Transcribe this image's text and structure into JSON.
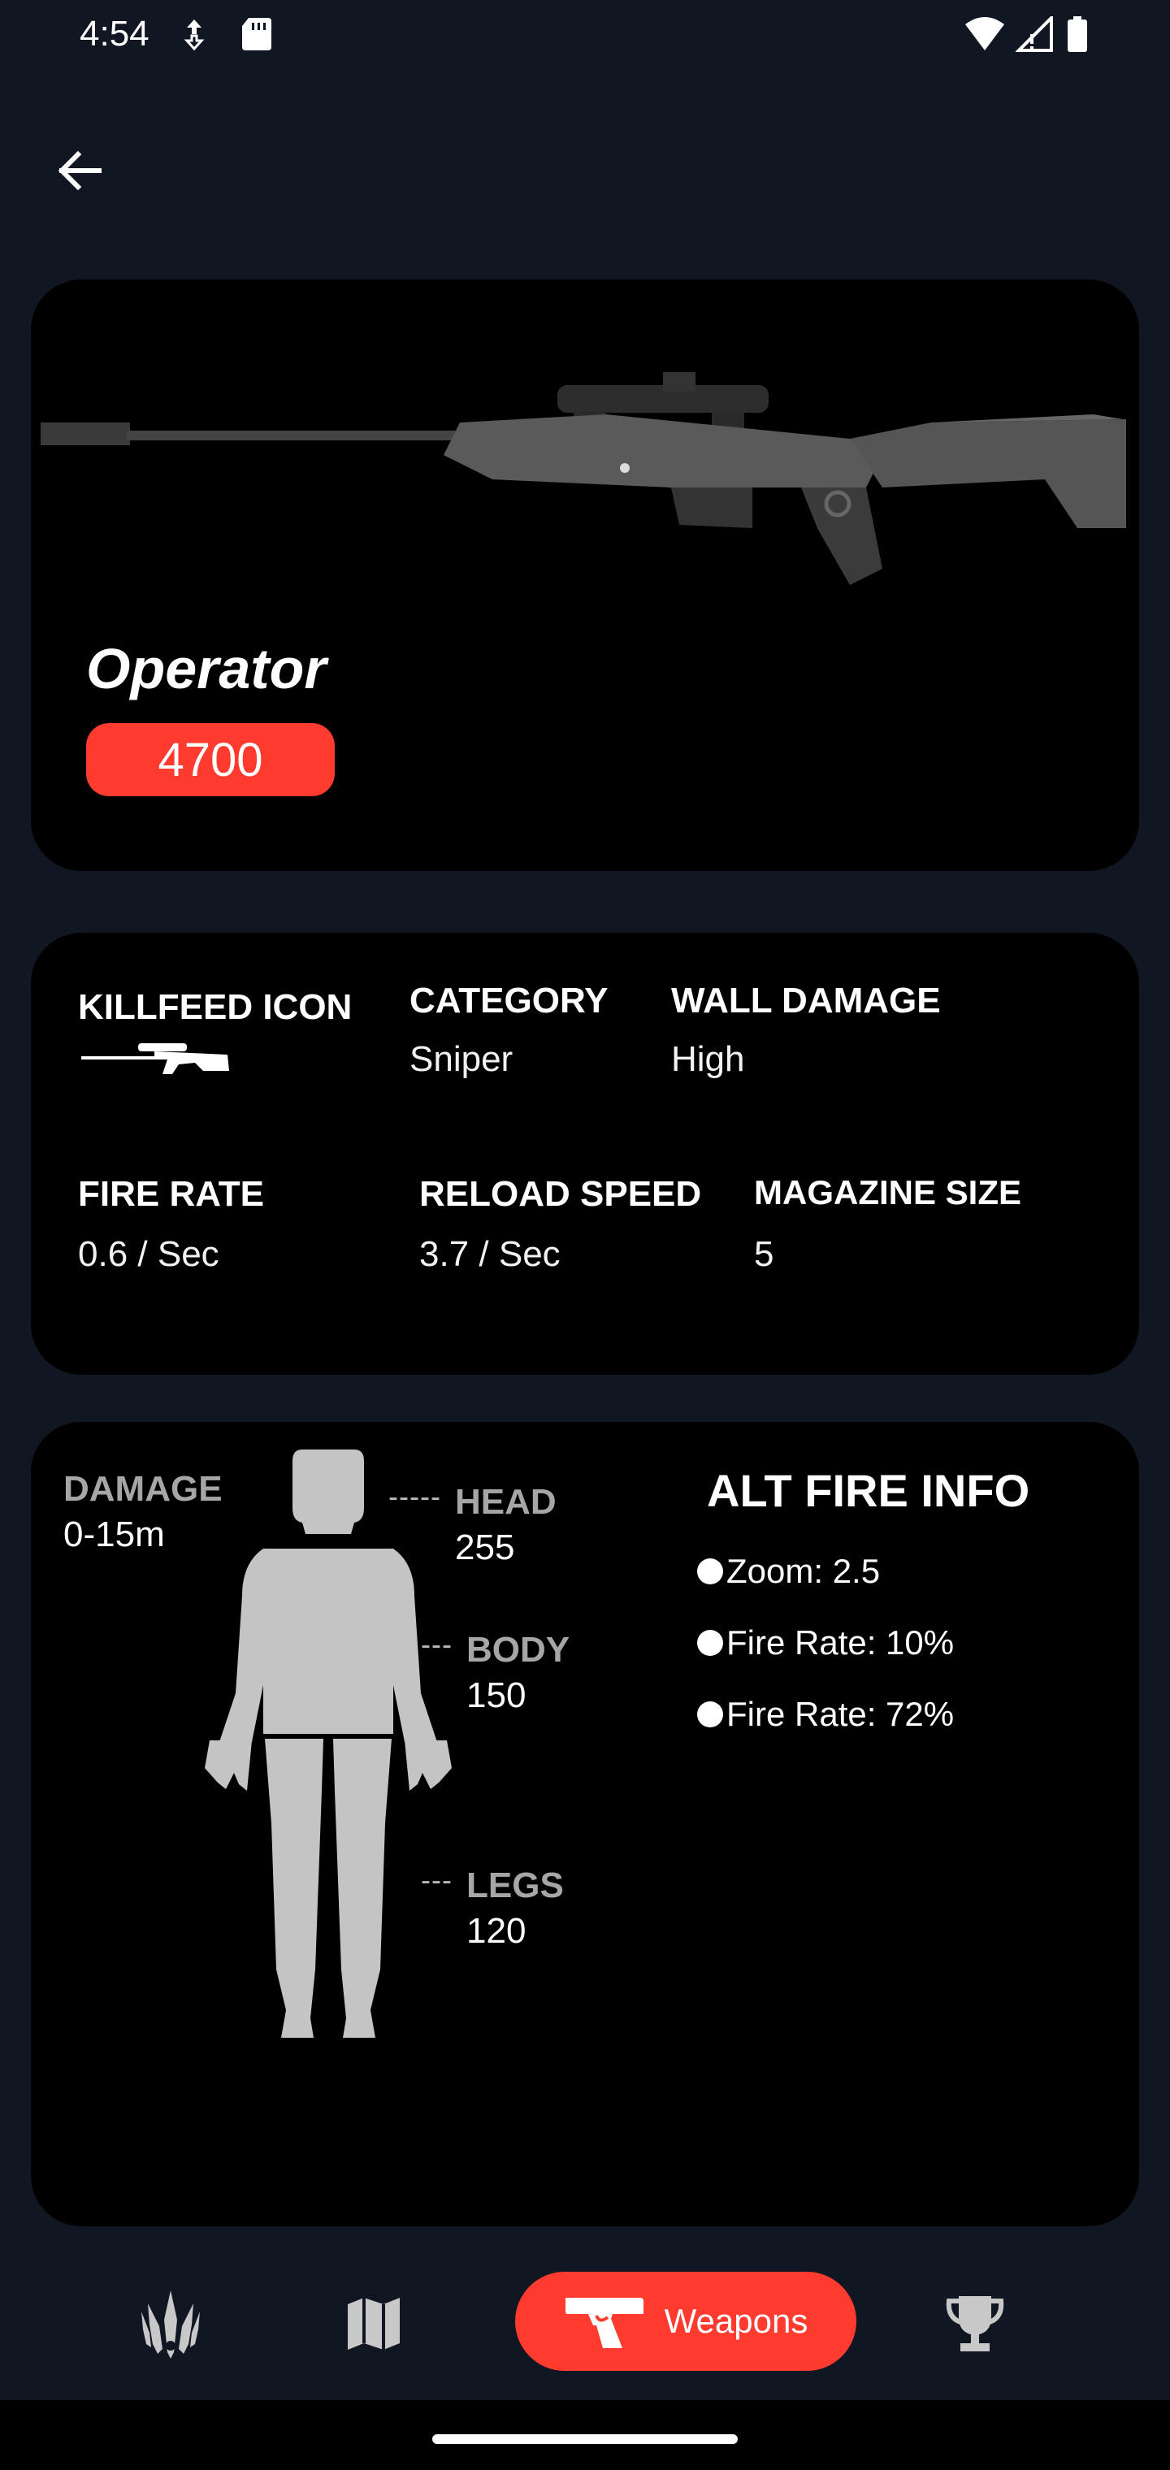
{
  "status_bar": {
    "time": "4:54",
    "icons": [
      "sim-data-icon",
      "sd-card-icon",
      "wifi-icon",
      "signal-icon",
      "battery-icon"
    ]
  },
  "header": {
    "back_icon": "arrow-left-icon"
  },
  "weapon": {
    "name": "Operator",
    "price": "4700"
  },
  "stats": {
    "killfeed_label": "KILLFEED ICON",
    "category_label": "CATEGORY",
    "category_value": "Sniper",
    "wall_damage_label": "WALL DAMAGE",
    "wall_damage_value": "High",
    "fire_rate_label": "FIRE RATE",
    "fire_rate_value": "0.6 / Sec",
    "reload_speed_label": "RELOAD SPEED",
    "reload_speed_value": "3.7 / Sec",
    "magazine_label": "MAGAZINE SIZE",
    "magazine_value": "5"
  },
  "damage": {
    "label": "DAMAGE",
    "range": "0-15m",
    "head_dash": "-----",
    "head_label": "HEAD",
    "head_value": "255",
    "body_dash": "---",
    "body_label": "BODY",
    "body_value": "150",
    "legs_dash": "---",
    "legs_label": "LEGS",
    "legs_value": "120"
  },
  "alt_fire": {
    "title": "ALT FIRE INFO",
    "items": [
      "Zoom: 2.5",
      "Fire Rate: 10%",
      "Fire Rate: 72%"
    ]
  },
  "bottom_nav": {
    "items": [
      {
        "icon": "agents-icon"
      },
      {
        "icon": "map-icon"
      },
      {
        "icon": "pistol-icon",
        "label": "Weapons",
        "active": true
      },
      {
        "icon": "trophy-icon"
      }
    ]
  },
  "colors": {
    "background": "#111722",
    "card": "#000000",
    "accent": "#ff3b30",
    "muted": "#a6a6a6"
  }
}
